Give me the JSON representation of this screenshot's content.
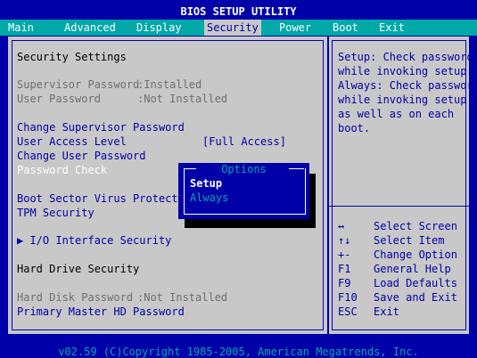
{
  "title": "BIOS SETUP UTILITY",
  "menu": {
    "items": [
      "Main",
      "Advanced",
      "Display",
      "Security",
      "Power",
      "Boot",
      "Exit"
    ],
    "active": "Security"
  },
  "left": {
    "section_title": "Security Settings",
    "supervisor_password": {
      "label": "Supervisor Password",
      "value": ":Installed"
    },
    "user_password": {
      "label": "User Password",
      "value": ":Not Installed"
    },
    "change_supervisor": "Change Supervisor Password",
    "user_access_level": {
      "label": "User Access Level",
      "value": "[Full Access]"
    },
    "change_user": "Change User Password",
    "password_check": "Password Check",
    "boot_sector": "Boot Sector Virus Protectio",
    "tpm_security": "TPM Security",
    "io_interface": "▶ I/O Interface Security",
    "hdd_section": "Hard Drive Security",
    "hdd_password": {
      "label": "Hard Disk Password",
      "value": ":Not Installed"
    },
    "primary_master": "Primary Master HD Password"
  },
  "help": {
    "lines": [
      "Setup: Check password",
      "while invoking setup.",
      "Always: Check password",
      "while invoking setup",
      "as well as on each",
      "boot."
    ]
  },
  "keys": [
    {
      "key": "↔",
      "desc": "Select Screen"
    },
    {
      "key": "↑↓",
      "desc": "Select Item"
    },
    {
      "key": "+-",
      "desc": "Change Option"
    },
    {
      "key": "F1",
      "desc": "General Help"
    },
    {
      "key": "F9",
      "desc": "Load Defaults"
    },
    {
      "key": "F10",
      "desc": "Save and Exit"
    },
    {
      "key": "ESC",
      "desc": "Exit"
    }
  ],
  "popup": {
    "title": "Options",
    "options": [
      "Setup",
      "Always"
    ],
    "selected": "Setup"
  },
  "footer": "v02.59 (C)Copyright 1985-2005, American Megatrends, Inc.",
  "colors": {
    "bios_blue": "#0000a8",
    "bios_cyan": "#00a8a8",
    "bios_grey": "#c8c8c8",
    "disabled_text": "#6e6e6e"
  }
}
